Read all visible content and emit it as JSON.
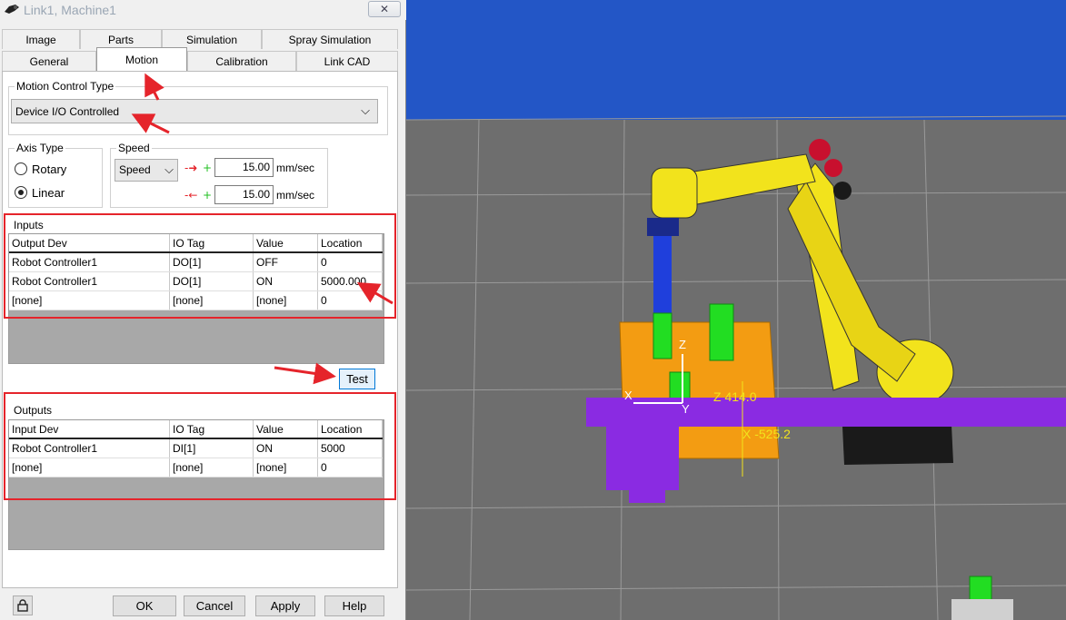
{
  "window": {
    "title": "Link1, Machine1",
    "close_label": "✕"
  },
  "tabs_top": [
    "Image",
    "Parts",
    "Simulation",
    "Spray Simulation"
  ],
  "tabs_bottom": [
    "General",
    "Motion",
    "Calibration",
    "Link CAD"
  ],
  "active_tab": "Motion",
  "motion_control": {
    "label": "Motion Control Type",
    "value": "Device I/O Controlled"
  },
  "axis_type": {
    "label": "Axis Type",
    "options": [
      "Rotary",
      "Linear"
    ],
    "selected": "Linear"
  },
  "speed": {
    "label": "Speed",
    "mode": "Speed",
    "forward": "15.00",
    "backward": "15.00",
    "unit": "mm/sec"
  },
  "inputs": {
    "label": "Inputs",
    "columns": [
      "Output Dev",
      "IO Tag",
      "Value",
      "Location"
    ],
    "rows": [
      [
        "Robot Controller1",
        "DO[1]",
        "OFF",
        "0"
      ],
      [
        "Robot Controller1",
        "DO[1]",
        "ON",
        "5000.000"
      ],
      [
        "[none]",
        "[none]",
        "[none]",
        "0"
      ]
    ]
  },
  "test_label": "Test",
  "outputs": {
    "label": "Outputs",
    "columns": [
      "Input Dev",
      "IO Tag",
      "Value",
      "Location"
    ],
    "rows": [
      [
        "Robot Controller1",
        "DI[1]",
        "ON",
        "5000"
      ],
      [
        "[none]",
        "[none]",
        "[none]",
        "0"
      ]
    ]
  },
  "footer": {
    "lock_icon": "lock-icon",
    "ok": "OK",
    "cancel": "Cancel",
    "apply": "Apply",
    "help": "Help"
  },
  "scene": {
    "axis_x": "X",
    "axis_y": "Y",
    "axis_z": "Z",
    "readout_z": "Z 414.0",
    "readout_x": "X -525.2"
  },
  "colors": {
    "annotation": "#e5242b",
    "robot": "#f2e31c",
    "conveyor": "#8a2be2",
    "fixture": "#f39c12",
    "part": "#22dd22",
    "tool": "#1f3fdc",
    "floor": "#6e6e6e"
  }
}
